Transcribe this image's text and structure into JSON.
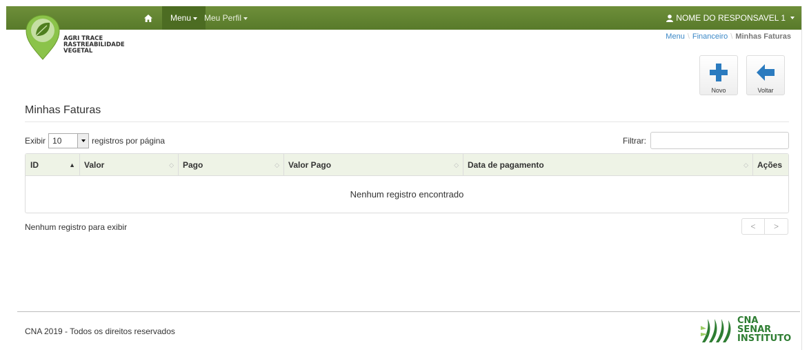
{
  "colors": {
    "navbar": "#5f8231",
    "navbar_active": "#4c6c22",
    "header_row": "#eef3e6",
    "link": "#3a87c6",
    "brand_green": "#2e7d32"
  },
  "navbar": {
    "home_icon": "home-icon",
    "menu_label": "Menu",
    "perfil_label": "Meu Perfil",
    "user_label": "NOME DO RESPONSAVEL 1"
  },
  "logo": {
    "line1": "AGRI TRACE",
    "line2": "RASTREABILIDADE",
    "line3": "VEGETAL"
  },
  "breadcrumb": {
    "item1": "Menu",
    "item2": "Financeiro",
    "item3": "Minhas Faturas"
  },
  "actions": {
    "novo_label": "Novo",
    "voltar_label": "Voltar"
  },
  "page": {
    "title": "Minhas Faturas"
  },
  "length": {
    "prefix": "Exibir",
    "selected": "10",
    "suffix": "registros por página"
  },
  "filter": {
    "label": "Filtrar:",
    "value": ""
  },
  "table": {
    "columns": [
      "ID",
      "Valor",
      "Pago",
      "Valor Pago",
      "Data de pagamento",
      "Ações"
    ],
    "rows": [],
    "empty_message": "Nenhum registro encontrado"
  },
  "info": {
    "text": "Nenhum registro para exibir"
  },
  "pager": {
    "prev": "<",
    "next": ">"
  },
  "footer": {
    "copyright": "CNA 2019 - Todos os direitos reservados",
    "logo_line1": "CNA",
    "logo_line2": "SENAR",
    "logo_line3": "INSTITUTO"
  }
}
